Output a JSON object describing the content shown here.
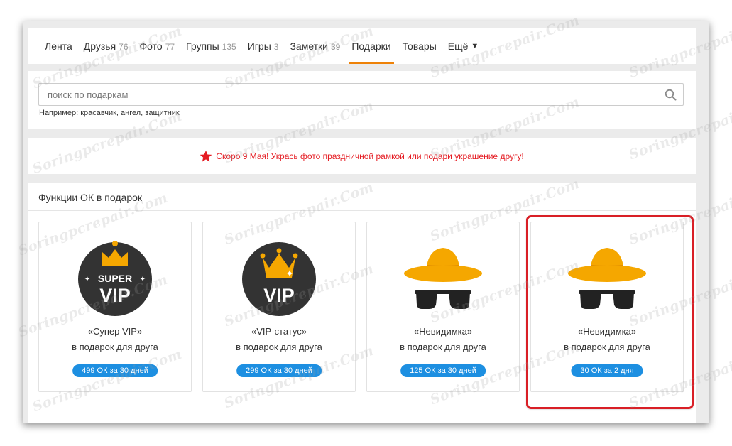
{
  "nav": {
    "items": [
      {
        "label": "Лента",
        "count": ""
      },
      {
        "label": "Друзья",
        "count": "76"
      },
      {
        "label": "Фото",
        "count": "77"
      },
      {
        "label": "Группы",
        "count": "135"
      },
      {
        "label": "Игры",
        "count": "3"
      },
      {
        "label": "Заметки",
        "count": "39"
      },
      {
        "label": "Подарки",
        "count": "",
        "active": true
      },
      {
        "label": "Товары",
        "count": ""
      }
    ],
    "more_label": "Ещё"
  },
  "search": {
    "placeholder": "поиск по подаркам",
    "examples_label": "Например:",
    "examples": [
      "красавчик",
      "ангел",
      "защитник"
    ],
    "icon": "search-icon"
  },
  "promo": {
    "text": "Скоро 9 Мая! Укрась фото праздничной рамкой или подари украшение другу!",
    "icon": "red-star-icon",
    "color": "#e51c23"
  },
  "functions": {
    "title": "Функции ОК в подарок",
    "gifts": [
      {
        "name": "«Супер VIP»",
        "desc": "в подарок для друга",
        "price": "499 ОК за 30 дней",
        "badge_top": "SUPER",
        "badge_main": "VIP",
        "icon": "super-vip-icon"
      },
      {
        "name": "«VIP-статус»",
        "desc": "в подарок для друга",
        "price": "299 ОК за 30 дней",
        "badge_main": "VIP",
        "icon": "vip-icon"
      },
      {
        "name": "«Невидимка»",
        "desc": "в подарок для друга",
        "price": "125 ОК за 30 дней",
        "icon": "invisible-hat-icon"
      },
      {
        "name": "«Невидимка»",
        "desc": "в подарок для друга",
        "price": "30 ОК за 2 дня",
        "icon": "invisible-hat-icon"
      }
    ]
  },
  "watermark": "Soringpcrepair.Com",
  "colors": {
    "accent": "#ee8208",
    "price_badge": "#1d8fe1",
    "highlight": "#d91f26",
    "hat": "#f5a700"
  }
}
